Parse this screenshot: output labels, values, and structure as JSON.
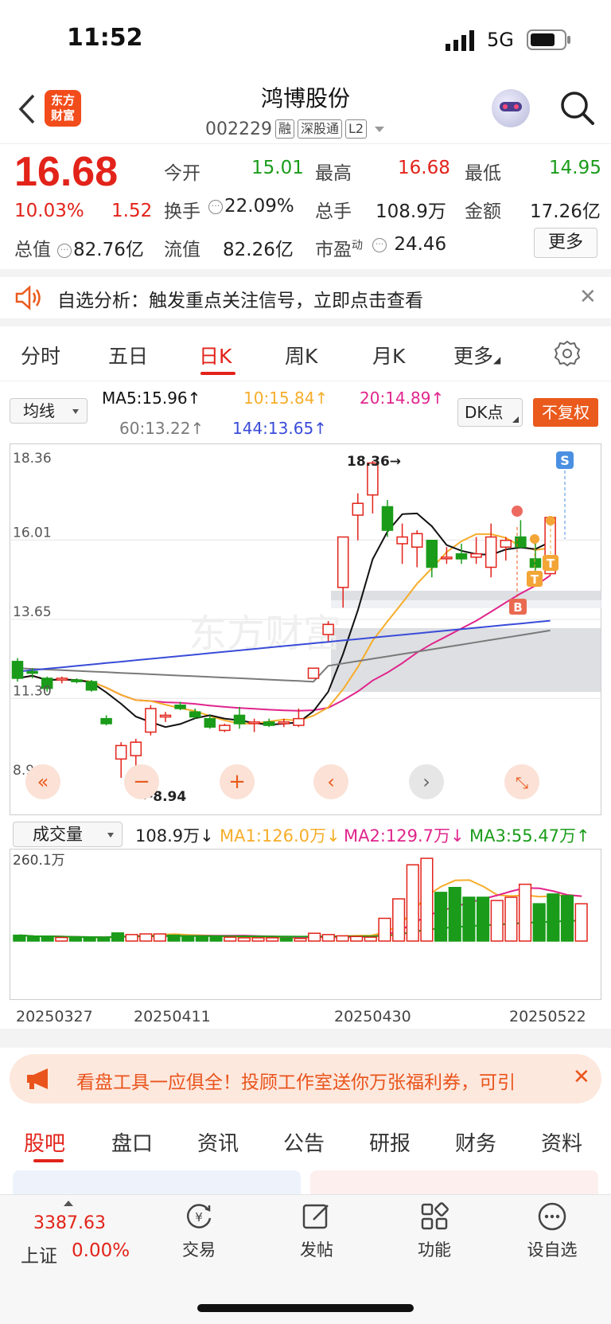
{
  "status_bar": {
    "time": "11:52",
    "network": "5G"
  },
  "header": {
    "brand_logo": "东方财富",
    "stock_name": "鸿博股份",
    "stock_code": "002229",
    "tags": [
      "融",
      "深股通",
      "L2"
    ]
  },
  "quote": {
    "price": "16.68",
    "change_pct": "10.03%",
    "change_amt": "1.52",
    "rows": [
      [
        {
          "label": "今开",
          "value": "15.01",
          "color": "green"
        },
        {
          "label": "最高",
          "value": "16.68",
          "color": "red"
        },
        {
          "label": "最低",
          "value": "14.95",
          "color": "green"
        }
      ],
      [
        {
          "label": "换手",
          "value": "22.09%",
          "color": "dark"
        },
        {
          "label": "总手",
          "value": "108.9万",
          "color": "dark"
        },
        {
          "label": "金额",
          "value": "17.26亿",
          "color": "dark"
        }
      ],
      [
        {
          "label": "总值",
          "value": "82.76亿",
          "color": "dark"
        },
        {
          "label": "流值",
          "value": "82.26亿",
          "color": "dark"
        },
        {
          "label": "市盈",
          "sup": "动",
          "value": "24.46",
          "color": "dark"
        }
      ]
    ],
    "more_label": "更多"
  },
  "alert": {
    "text": "自选分析：触发重点关注信号，立即点击查看"
  },
  "period_tabs": [
    "分时",
    "五日",
    "日K",
    "周K",
    "月K",
    "更多"
  ],
  "ma_bar": {
    "selector": "均线",
    "ma5": "MA5:15.96↑",
    "ma10": "10:15.84↑",
    "ma20": "20:14.89↑",
    "ma60": "60:13.22↑",
    "ma144": "144:13.65↑",
    "dk_label": "DK点",
    "fq_label": "不复权",
    "colors": {
      "ma5": "#111111",
      "ma10": "#f6ad2b",
      "ma20": "#e0258c",
      "ma60": "#7a7a7a",
      "ma144": "#3a4cd8"
    }
  },
  "kline": {
    "y_labels": [
      "18.36",
      "16.01",
      "13.65",
      "11.30",
      "8.94"
    ],
    "max_label": "18.36→",
    "min_label": "←8.94",
    "markers": [
      "S",
      "B",
      "T",
      "T"
    ],
    "chart_data": {
      "type": "candlestick",
      "ylim": [
        8.94,
        18.36
      ],
      "candles": [
        {
          "o": 12.4,
          "h": 12.5,
          "l": 11.8,
          "c": 11.9
        },
        {
          "o": 12.1,
          "h": 12.2,
          "l": 11.9,
          "c": 12.05
        },
        {
          "o": 11.9,
          "h": 11.95,
          "l": 11.5,
          "c": 11.6
        },
        {
          "o": 11.85,
          "h": 11.95,
          "l": 11.75,
          "c": 11.9
        },
        {
          "o": 11.85,
          "h": 11.9,
          "l": 11.75,
          "c": 11.8
        },
        {
          "o": 11.8,
          "h": 11.85,
          "l": 11.5,
          "c": 11.55
        },
        {
          "o": 10.7,
          "h": 10.8,
          "l": 10.5,
          "c": 10.55
        },
        {
          "o": 9.5,
          "h": 10.0,
          "l": 8.94,
          "c": 9.9
        },
        {
          "o": 9.6,
          "h": 10.1,
          "l": 8.94,
          "c": 10.0
        },
        {
          "o": 10.3,
          "h": 11.1,
          "l": 10.2,
          "c": 11.0
        },
        {
          "o": 10.75,
          "h": 10.9,
          "l": 10.6,
          "c": 10.8
        },
        {
          "o": 11.1,
          "h": 11.2,
          "l": 10.95,
          "c": 11.0
        },
        {
          "o": 10.9,
          "h": 11.0,
          "l": 10.7,
          "c": 10.75
        },
        {
          "o": 10.7,
          "h": 10.8,
          "l": 10.4,
          "c": 10.45
        },
        {
          "o": 10.35,
          "h": 10.55,
          "l": 10.3,
          "c": 10.5
        },
        {
          "o": 10.8,
          "h": 11.05,
          "l": 10.4,
          "c": 10.55
        },
        {
          "o": 10.6,
          "h": 10.7,
          "l": 10.3,
          "c": 10.6
        },
        {
          "o": 10.6,
          "h": 10.7,
          "l": 10.45,
          "c": 10.5
        },
        {
          "o": 10.55,
          "h": 10.7,
          "l": 10.45,
          "c": 10.6
        },
        {
          "o": 10.5,
          "h": 11.0,
          "l": 10.45,
          "c": 10.7
        },
        {
          "o": 11.9,
          "h": 12.2,
          "l": 11.9,
          "c": 12.2
        },
        {
          "o": 13.2,
          "h": 13.6,
          "l": 13.0,
          "c": 13.5
        },
        {
          "o": 14.6,
          "h": 16.1,
          "l": 14.0,
          "c": 16.1
        },
        {
          "o": 16.75,
          "h": 17.4,
          "l": 16.0,
          "c": 17.1
        },
        {
          "o": 17.35,
          "h": 18.36,
          "l": 16.8,
          "c": 18.3
        },
        {
          "o": 17.0,
          "h": 17.2,
          "l": 16.1,
          "c": 16.3
        },
        {
          "o": 15.9,
          "h": 16.5,
          "l": 15.3,
          "c": 16.1
        },
        {
          "o": 15.8,
          "h": 16.3,
          "l": 15.2,
          "c": 16.2
        },
        {
          "o": 16.0,
          "h": 16.0,
          "l": 14.9,
          "c": 15.2
        },
        {
          "o": 15.5,
          "h": 15.8,
          "l": 15.3,
          "c": 15.5
        },
        {
          "o": 15.6,
          "h": 15.9,
          "l": 15.3,
          "c": 15.45
        },
        {
          "o": 15.5,
          "h": 16.1,
          "l": 15.3,
          "c": 15.6
        },
        {
          "o": 15.2,
          "h": 16.5,
          "l": 14.9,
          "c": 16.1
        },
        {
          "o": 15.8,
          "h": 16.1,
          "l": 15.4,
          "c": 16.0
        },
        {
          "o": 16.1,
          "h": 16.6,
          "l": 15.8,
          "c": 15.8
        },
        {
          "o": 15.45,
          "h": 15.95,
          "l": 15.1,
          "c": 15.2
        },
        {
          "o": 15.01,
          "h": 16.68,
          "l": 14.95,
          "c": 16.68
        }
      ]
    }
  },
  "volume": {
    "selector": "成交量",
    "current": "108.9万↓",
    "ma1": "MA1:126.0万↓",
    "ma2": "MA2:129.7万↓",
    "ma3": "MA3:55.47万↑",
    "y_label": "260.1万",
    "dates": [
      "20250327",
      "20250411",
      "20250430",
      "20250522"
    ],
    "chart_data": {
      "type": "bar",
      "ylim": [
        0,
        260.1
      ],
      "values": [
        18,
        12,
        14,
        11,
        9,
        10,
        8,
        25,
        20,
        22,
        22,
        18,
        14,
        14,
        12,
        12,
        10,
        10,
        10,
        9,
        8,
        24,
        20,
        16,
        14,
        12,
        70,
        130,
        235,
        255,
        150,
        165,
        135,
        135,
        125,
        135,
        175,
        115,
        145,
        140,
        115
      ],
      "up": [
        0,
        0,
        0,
        1,
        0,
        0,
        0,
        0,
        1,
        1,
        1,
        0,
        0,
        0,
        0,
        1,
        1,
        1,
        1,
        0,
        1,
        1,
        1,
        1,
        1,
        1,
        1,
        1,
        1,
        1,
        0,
        0,
        0,
        0,
        1,
        1,
        1,
        0,
        0,
        0,
        1
      ]
    }
  },
  "promo": {
    "text": "看盘工具一应俱全！投顾工作室送你万张福利券，可引"
  },
  "bottom_tabs": [
    "股吧",
    "盘口",
    "资讯",
    "公告",
    "研报",
    "财务",
    "资料"
  ],
  "bottom_nav": {
    "index_value": "3387.63",
    "index_name": "上证",
    "index_pct": "0.00%",
    "buttons": [
      "交易",
      "发帖",
      "功能",
      "设自选"
    ]
  }
}
